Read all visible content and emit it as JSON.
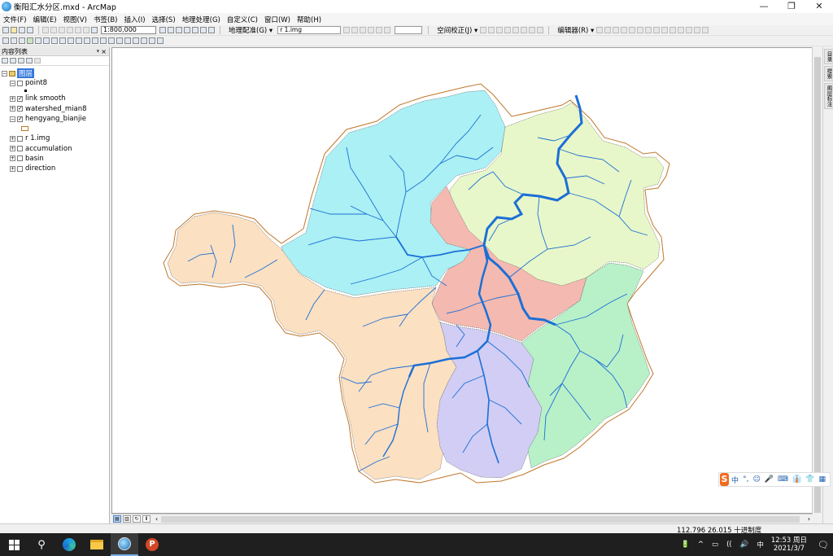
{
  "window": {
    "title": "衡阳汇水分区.mxd - ArcMap",
    "controls": [
      "—",
      "❐",
      "✕"
    ]
  },
  "menu": [
    "文件(F)",
    "编辑(E)",
    "视图(V)",
    "书签(B)",
    "插入(I)",
    "选择(S)",
    "地理处理(G)",
    "自定义(C)",
    "窗口(W)",
    "帮助(H)"
  ],
  "toolbar": {
    "scale": "1:800,000",
    "georef_label": "地理配准(G) ▾",
    "georef_layer": "r 1.img",
    "spatial_adjust_label": "空间校正(J) ▾",
    "editor_label": "编辑器(R) ▾"
  },
  "toc": {
    "title": "内容列表",
    "pin": "ᵠ",
    "close": "×",
    "root_label": "图层",
    "layers": [
      {
        "name": "point8",
        "checked": false,
        "expanded": true
      },
      {
        "name": "link smooth",
        "checked": true,
        "expanded": false
      },
      {
        "name": "watershed_mian8",
        "checked": true,
        "expanded": false
      },
      {
        "name": "hengyang_bianjie",
        "checked": true,
        "expanded": true
      },
      {
        "name": "r 1.img",
        "checked": false,
        "expanded": false
      },
      {
        "name": "accumulation",
        "checked": false,
        "expanded": false
      },
      {
        "name": "basin",
        "checked": false,
        "expanded": false
      },
      {
        "name": "direction",
        "checked": false,
        "expanded": false
      }
    ]
  },
  "map": {
    "boundary_color": "#c0762a",
    "river_color": "#1c6fd6",
    "basin_colors": {
      "north": "#aaf0f4",
      "northeast": "#e8f7c9",
      "center": "#f4b9b0",
      "west": "#fbe0c2",
      "south": "#d1cdf4",
      "east": "#b8f0c8"
    }
  },
  "right_dock": [
    "目录",
    "搜索",
    "图层标注"
  ],
  "ime": {
    "logo": "S",
    "items": [
      "中",
      "°,",
      "☺",
      "🎤",
      "⌨",
      "👔",
      "👕",
      "▦"
    ]
  },
  "status": {
    "coords": "112.796  26.015 十进制度"
  },
  "taskbar": {
    "tray": [
      "🔋",
      "^",
      "▭",
      "((",
      "🔊",
      "中"
    ],
    "time": "12:53 周日",
    "date": "2021/3/7"
  }
}
